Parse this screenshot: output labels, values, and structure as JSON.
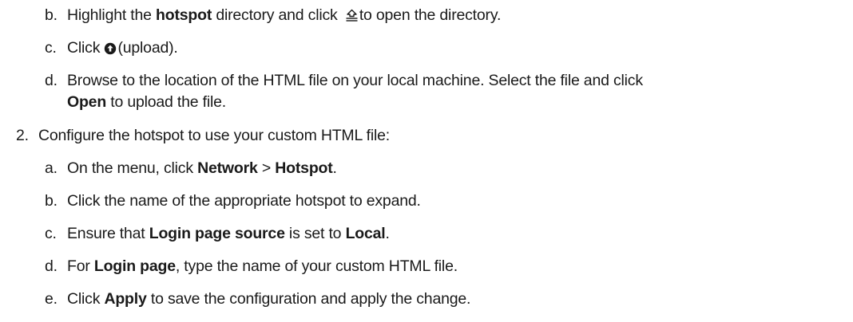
{
  "steps": {
    "s1b": {
      "marker": "b.",
      "t1": "Highlight the ",
      "b1": "hotspot",
      "t2": " directory and click ",
      "t3": "to open the directory."
    },
    "s1c": {
      "marker": "c.",
      "t1": "Click ",
      "t2": "(upload)."
    },
    "s1d": {
      "marker": "d.",
      "t1": "Browse to the location of the HTML file on your local machine. Select the file and click",
      "b1": "Open",
      "t2": " to upload the file."
    },
    "s2": {
      "marker": "2.",
      "t1": "Configure the hotspot to use your custom HTML file:"
    },
    "s2a": {
      "marker": "a.",
      "t1": "On the menu, click ",
      "b1": "Network",
      "t2": " > ",
      "b2": "Hotspot",
      "t3": "."
    },
    "s2b": {
      "marker": "b.",
      "t1": "Click the name of the appropriate hotspot to expand."
    },
    "s2c": {
      "marker": "c.",
      "t1": "Ensure that ",
      "b1": "Login page source",
      "t2": " is set to ",
      "b2": "Local",
      "t3": "."
    },
    "s2d": {
      "marker": "d.",
      "t1": "For ",
      "b1": "Login page",
      "t2": ", type the name of your custom HTML file."
    },
    "s2e": {
      "marker": "e.",
      "t1": "Click ",
      "b1": "Apply",
      "t2": " to save the configuration and apply the change."
    }
  },
  "icons": {
    "open_directory": "open-directory-icon",
    "upload": "upload-icon"
  }
}
